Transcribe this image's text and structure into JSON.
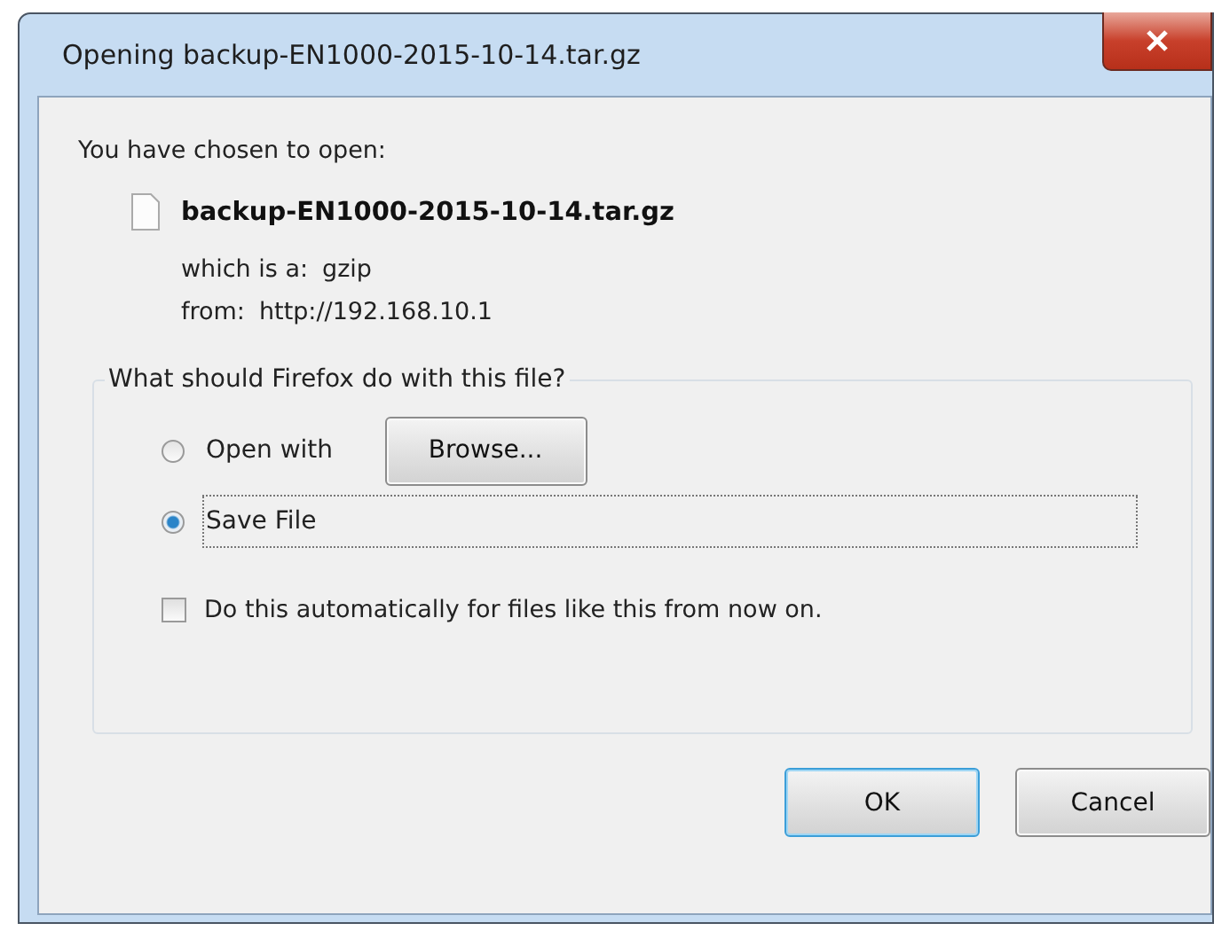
{
  "window": {
    "title": "Opening backup-EN1000-2015-10-14.tar.gz"
  },
  "intro": "You have chosen to open:",
  "file": {
    "name": "backup-EN1000-2015-10-14.tar.gz"
  },
  "details": [
    {
      "label": "which is a:",
      "value": "gzip"
    },
    {
      "label": "from:",
      "value": "http://192.168.10.1"
    }
  ],
  "group": {
    "legend": "What should Firefox do with this file?",
    "options": [
      {
        "label": "Open with",
        "selected": false,
        "button": "Browse..."
      },
      {
        "label": "Save File",
        "selected": true
      }
    ],
    "auto": {
      "label": "Do this automatically for files like this from now on.",
      "checked": false
    }
  },
  "buttons": [
    {
      "label": "OK",
      "default": true
    },
    {
      "label": "Cancel",
      "default": false
    }
  ]
}
